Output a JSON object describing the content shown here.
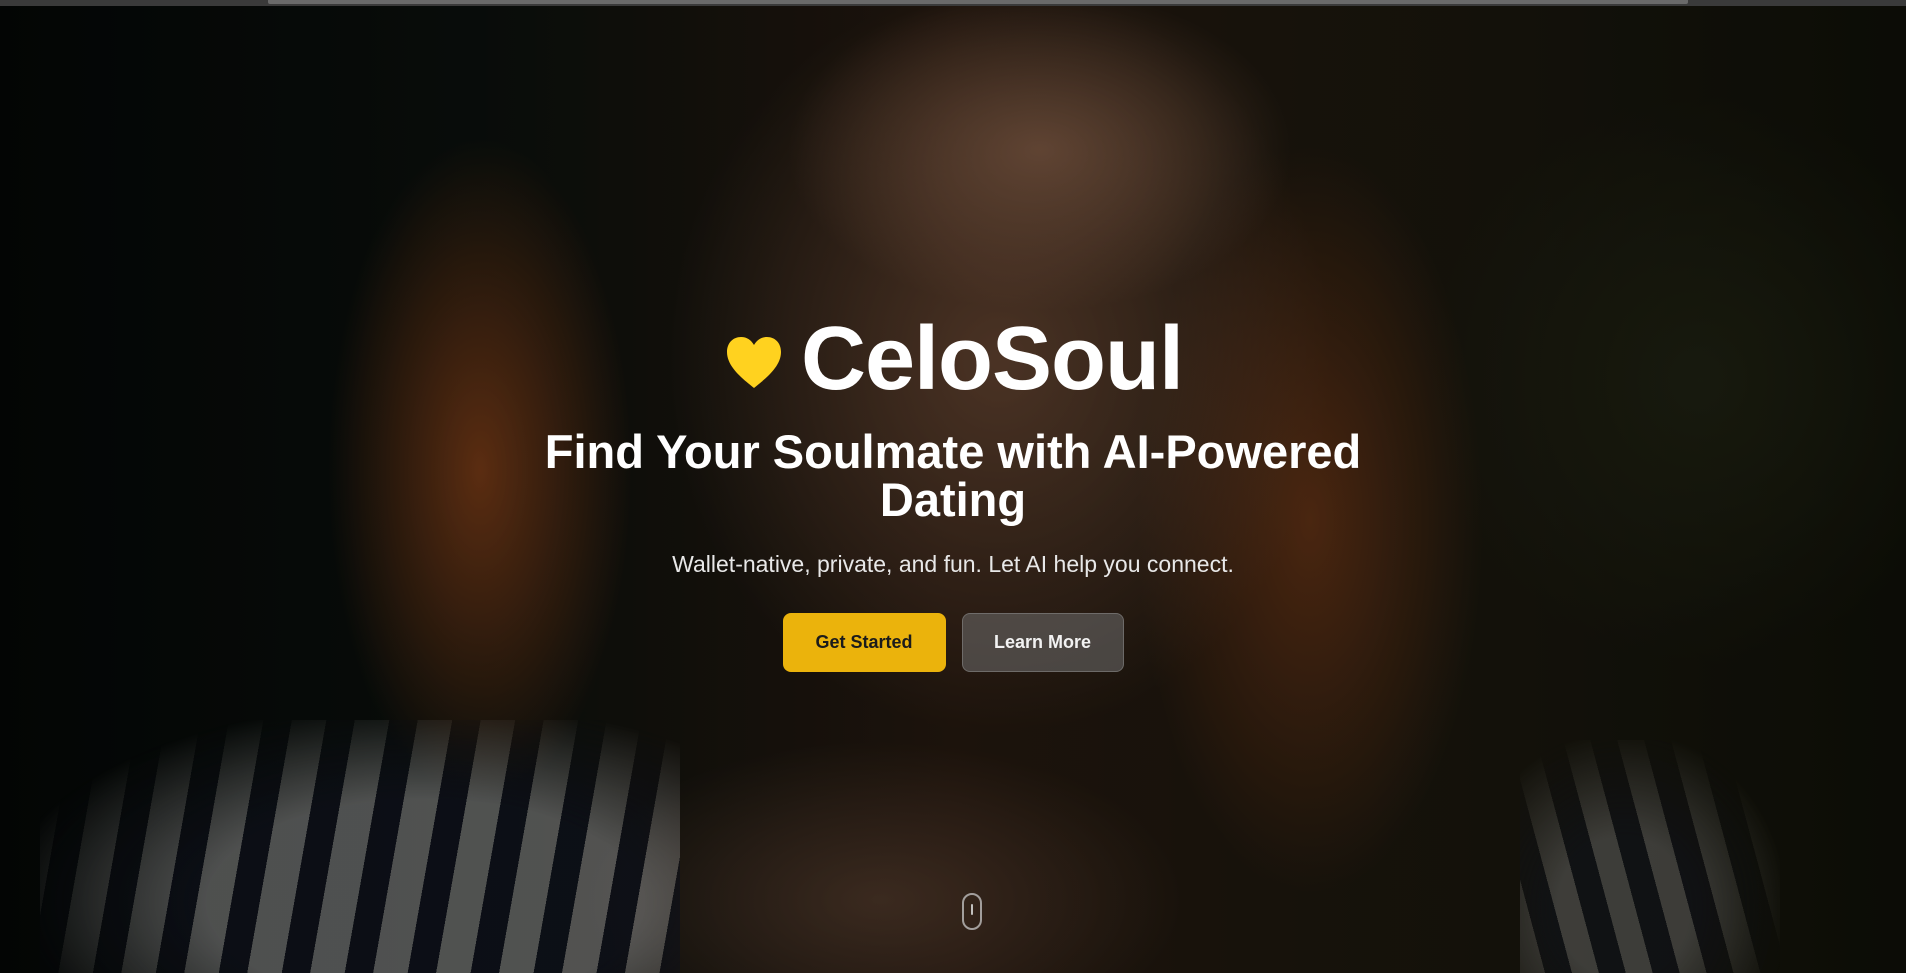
{
  "brand": {
    "name": "CeloSoul",
    "icon": "heart-icon",
    "icon_color": "#ffd21f"
  },
  "hero": {
    "headline": "Find Your Soulmate with AI-Powered Dating",
    "subtitle": "Wallet-native, private, and fun. Let AI help you connect.",
    "background_image": "portrait-photo"
  },
  "buttons": {
    "primary_label": "Get Started",
    "secondary_label": "Learn More"
  },
  "scroll_indicator": {
    "icon": "mouse-scroll-icon"
  },
  "colors": {
    "accent": "#ebb30c",
    "text": "#ffffff"
  }
}
